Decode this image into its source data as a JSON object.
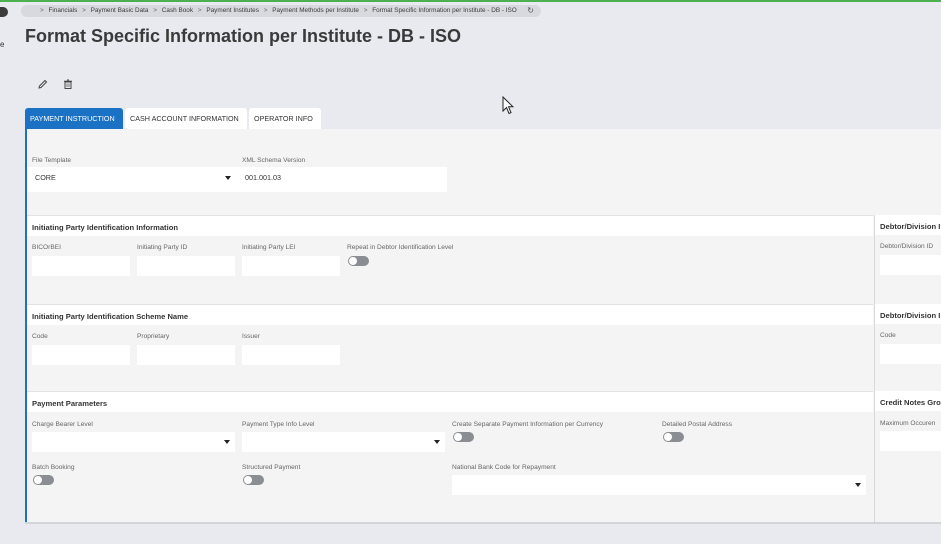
{
  "breadcrumb": {
    "items": [
      "Financials",
      "Payment Basic Data",
      "Cash Book",
      "Payment Institutes",
      "Payment Methods per Institute",
      "Format Specific Information per Institute - DB - ISO"
    ],
    "refresh_icon": "refresh-icon"
  },
  "page": {
    "title": "Format Specific Information per Institute - DB - ISO"
  },
  "toolbar": {
    "edit_icon": "pencil-icon",
    "delete_icon": "trash-icon"
  },
  "tabs": [
    {
      "label": "PAYMENT INSTRUCTION",
      "active": true
    },
    {
      "label": "CASH ACCOUNT INFORMATION",
      "active": false
    },
    {
      "label": "OPERATOR INFO",
      "active": false
    }
  ],
  "general": {
    "file_template_label": "File Template",
    "file_template_value": "CORE",
    "xml_schema_label": "XML Schema Version",
    "xml_schema_value": "001.001.03"
  },
  "initiating_party": {
    "title": "Initiating Party Identification Information",
    "bic_label": "BICOrBEI",
    "id_label": "Initiating Party ID",
    "lei_label": "Initiating Party LEI",
    "repeat_label": "Repeat in Debtor Identification Level"
  },
  "scheme_name": {
    "title": "Initiating Party Identification Scheme Name",
    "code_label": "Code",
    "proprietary_label": "Proprietary",
    "issuer_label": "Issuer"
  },
  "payment_parameters": {
    "title": "Payment Parameters",
    "charge_bearer_label": "Charge Bearer Level",
    "payment_type_label": "Payment Type Info Level",
    "separate_payment_label": "Create Separate Payment Information per Currency",
    "detailed_postal_label": "Detailed Postal Address",
    "batch_booking_label": "Batch Booking",
    "structured_payment_label": "Structured Payment",
    "national_bank_label": "National Bank Code for Repayment"
  },
  "right_column": {
    "debtor_title_1": "Debtor/Division I",
    "debtor_id_label": "Debtor/Division ID",
    "debtor_title_2": "Debtor/Division I",
    "code_label": "Code",
    "credit_notes_title": "Credit Notes Gro",
    "max_occurrence_label": "Maximum Occuren"
  },
  "colors": {
    "accent": "#1b72c4",
    "toggle_off": "#8a8d92",
    "background": "#e8eaef"
  }
}
